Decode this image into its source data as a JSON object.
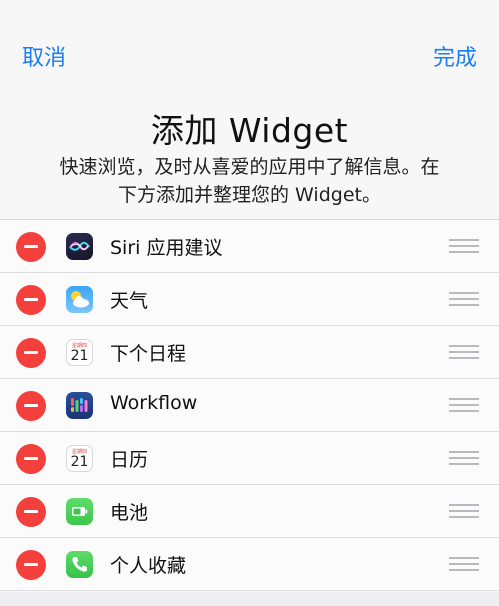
{
  "nav": {
    "cancel_label": "取消",
    "done_label": "完成",
    "accent_color": "#1a7ef3"
  },
  "header": {
    "title": "添加 Widget",
    "subtitle_line1": "快速浏览，及时从喜爱的应用中了解信息。在",
    "subtitle_line2": "下方添加并整理您的 Widget。"
  },
  "widgets": [
    {
      "label": "Siri 应用建议",
      "icon": "siri-suggestions-icon"
    },
    {
      "label": "天气",
      "icon": "weather-icon"
    },
    {
      "label": "下个日程",
      "icon": "calendar-icon",
      "cal_day": "21",
      "cal_weekday": "星期四"
    },
    {
      "label": "Workflow",
      "icon": "workflow-icon"
    },
    {
      "label": "日历",
      "icon": "calendar-icon",
      "cal_day": "21",
      "cal_weekday": "星期四"
    },
    {
      "label": "电池",
      "icon": "battery-icon"
    },
    {
      "label": "个人收藏",
      "icon": "phone-icon"
    }
  ],
  "colors": {
    "remove_red": "#f4403c"
  }
}
